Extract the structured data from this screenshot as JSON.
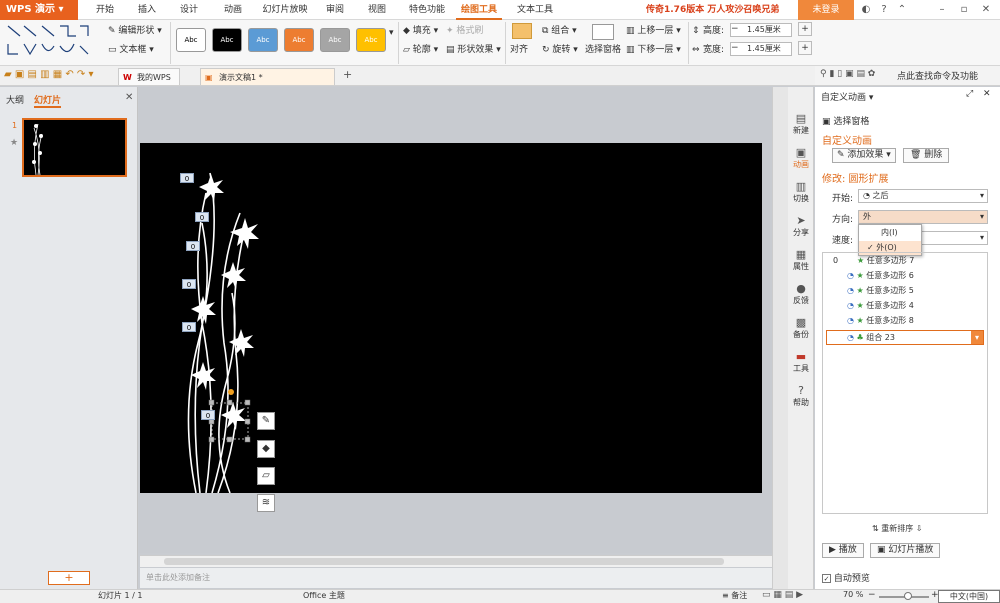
{
  "app": {
    "name": "WPS 演示"
  },
  "tabs": [
    {
      "label": "开始"
    },
    {
      "label": "插入"
    },
    {
      "label": "设计"
    },
    {
      "label": "动画"
    },
    {
      "label": "幻灯片放映"
    },
    {
      "label": "审阅"
    },
    {
      "label": "视图"
    },
    {
      "label": "特色功能"
    },
    {
      "label": "绘图工具"
    },
    {
      "label": "文本工具"
    }
  ],
  "promo": "传奇1.76版本 万人攻沙召唤兄弟",
  "login": "未登录",
  "ribbon": {
    "edit_shape": "编辑形状",
    "text_box": "文本框",
    "swatch_text": "Abc",
    "fill": "填充",
    "format_brush": "格式刷",
    "outline": "轮廓",
    "shape_effect": "形状效果",
    "align": "对齐",
    "rotate": "旋转",
    "group": "组合",
    "select_pane": "选择窗格",
    "bring_forward": "上移一层",
    "send_backward": "下移一层",
    "height_label": "高度:",
    "height_value": "1.45厘米",
    "width_label": "宽度:",
    "width_value": "1.45厘米",
    "find_cmd": "点此查找命令及功能"
  },
  "doc_tabs": {
    "tab1": "我的WPS",
    "tab2": "演示文稿1 *"
  },
  "left_pane": {
    "outline_tab": "大纲",
    "slides_tab": "幻灯片",
    "slide_number": "1",
    "add_button": "+"
  },
  "slide": {
    "labels": [
      "0",
      "0",
      "0",
      "0",
      "0",
      "0"
    ]
  },
  "notes_placeholder": "单击此处添加备注",
  "right_bar": [
    {
      "label": "新建"
    },
    {
      "label": "动画"
    },
    {
      "label": "切换"
    },
    {
      "label": "分享"
    },
    {
      "label": "属性"
    },
    {
      "label": "反馈"
    },
    {
      "label": "备份"
    },
    {
      "label": "工具"
    },
    {
      "label": "帮助"
    }
  ],
  "task_pane": {
    "header": "自定义动画",
    "select_pane": "选择窗格",
    "section_title": "自定义动画",
    "add_effect": "添加效果",
    "delete": "删除",
    "modify": "修改: 圆形扩展",
    "start_label": "开始:",
    "start_value": "之后",
    "direction_label": "方向:",
    "direction_value": "外",
    "speed_label": "速度:",
    "dropdown_options": [
      "内(I)",
      "外(O)"
    ],
    "animation_items": [
      {
        "index": "0",
        "name": "任意多边形 7"
      },
      {
        "index": "",
        "name": "任意多边形 6"
      },
      {
        "index": "",
        "name": "任意多边形 5"
      },
      {
        "index": "",
        "name": "任意多边形 4"
      },
      {
        "index": "",
        "name": "任意多边形 8"
      },
      {
        "index": "",
        "name": "组合 23"
      }
    ],
    "reorder_label": "重新排序",
    "play_button": "播放",
    "slideshow_button": "幻灯片播放",
    "autopreview_label": "自动预览"
  },
  "status": {
    "slide_count": "幻灯片 1 / 1",
    "theme": "Office 主题",
    "notes": "备注",
    "zoom": "70 %",
    "language": "中文(中国)"
  },
  "colors": {
    "accent": "#e06c1d",
    "slide_bg": "#000000",
    "active_tab": "#e06c1d"
  }
}
